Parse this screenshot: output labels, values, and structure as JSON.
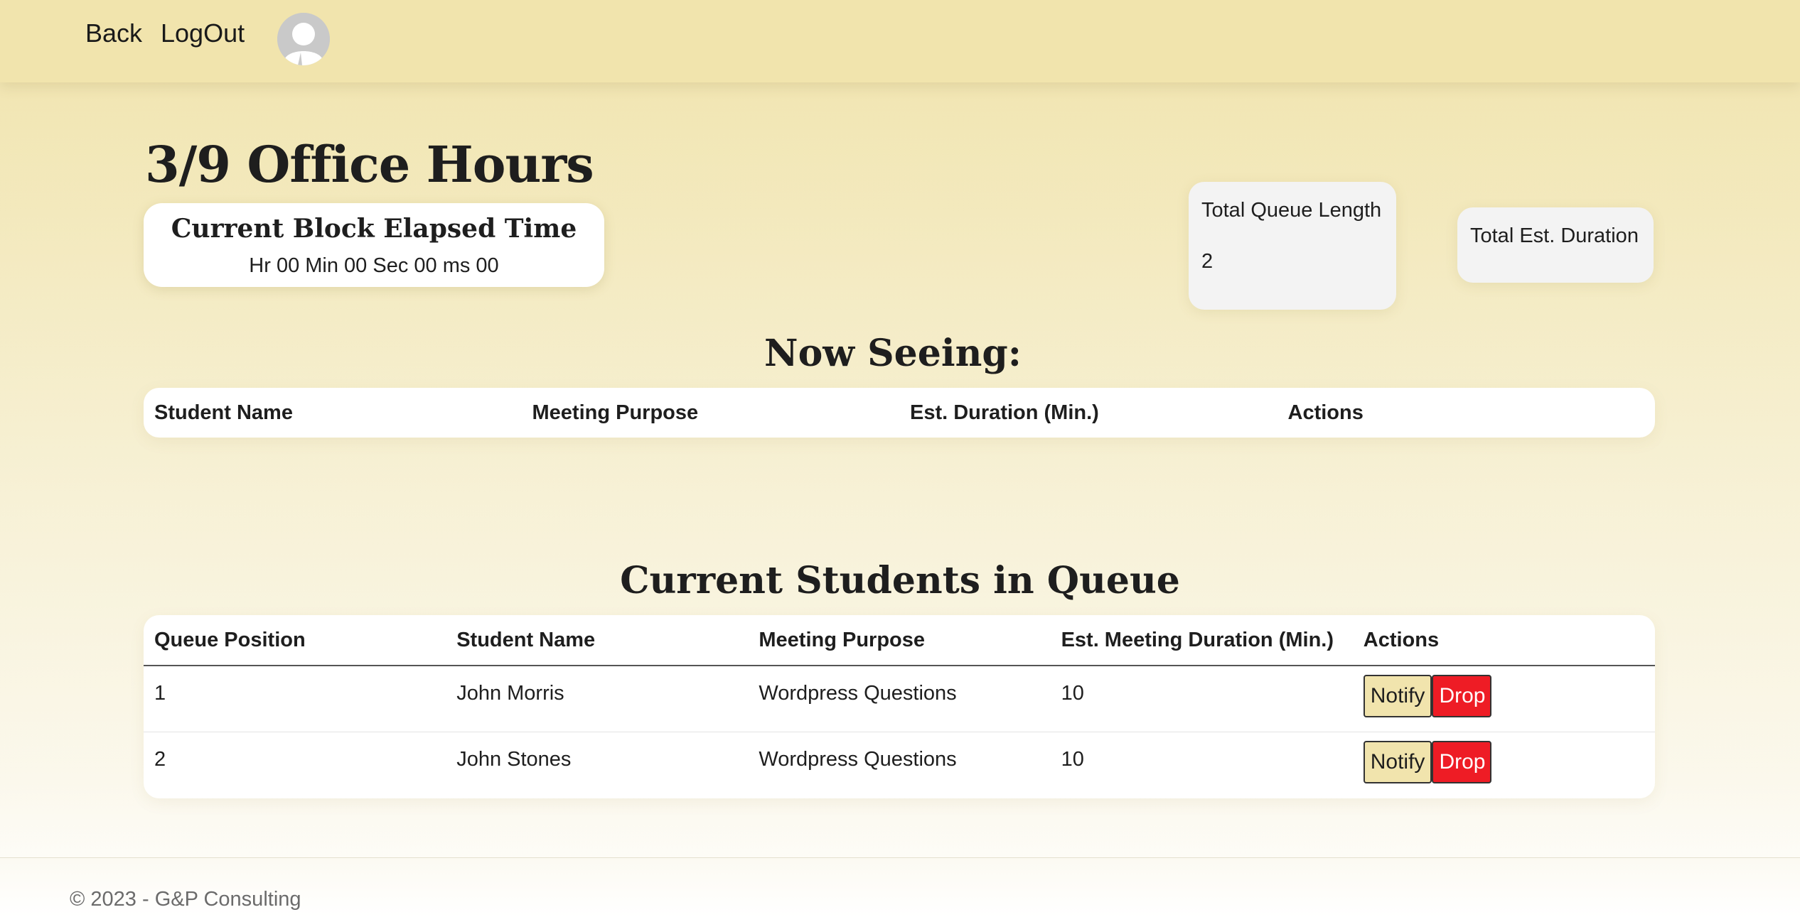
{
  "nav": {
    "back_label": "Back",
    "logout_label": "LogOut"
  },
  "page": {
    "title": "3/9 Office Hours"
  },
  "timer": {
    "title": "Current Block Elapsed Time",
    "value": "Hr 00 Min 00 Sec 00 ms 00"
  },
  "stats": {
    "queue_length_label": "Total Queue Length",
    "queue_length_value": "2",
    "est_duration_label": "Total Est. Duration"
  },
  "now_seeing": {
    "title": "Now Seeing:",
    "columns": [
      "Student Name",
      "Meeting Purpose",
      "Est. Duration (Min.)",
      "Actions"
    ]
  },
  "queue": {
    "title": "Current Students in Queue",
    "columns": [
      "Queue Position",
      "Student Name",
      "Meeting Purpose",
      "Est. Meeting Duration (Min.)",
      "Actions"
    ],
    "rows": [
      {
        "position": "1",
        "name": "John Morris",
        "purpose": "Wordpress Questions",
        "duration": "10"
      },
      {
        "position": "2",
        "name": "John Stones",
        "purpose": "Wordpress Questions",
        "duration": "10"
      }
    ],
    "notify_label": "Notify",
    "drop_label": "Drop"
  },
  "footer": {
    "text": "© 2023 - G&P Consulting"
  },
  "colors": {
    "background": "#f1e4ad",
    "notify_button": "#f1e4ad",
    "drop_button": "#ee1c25"
  }
}
